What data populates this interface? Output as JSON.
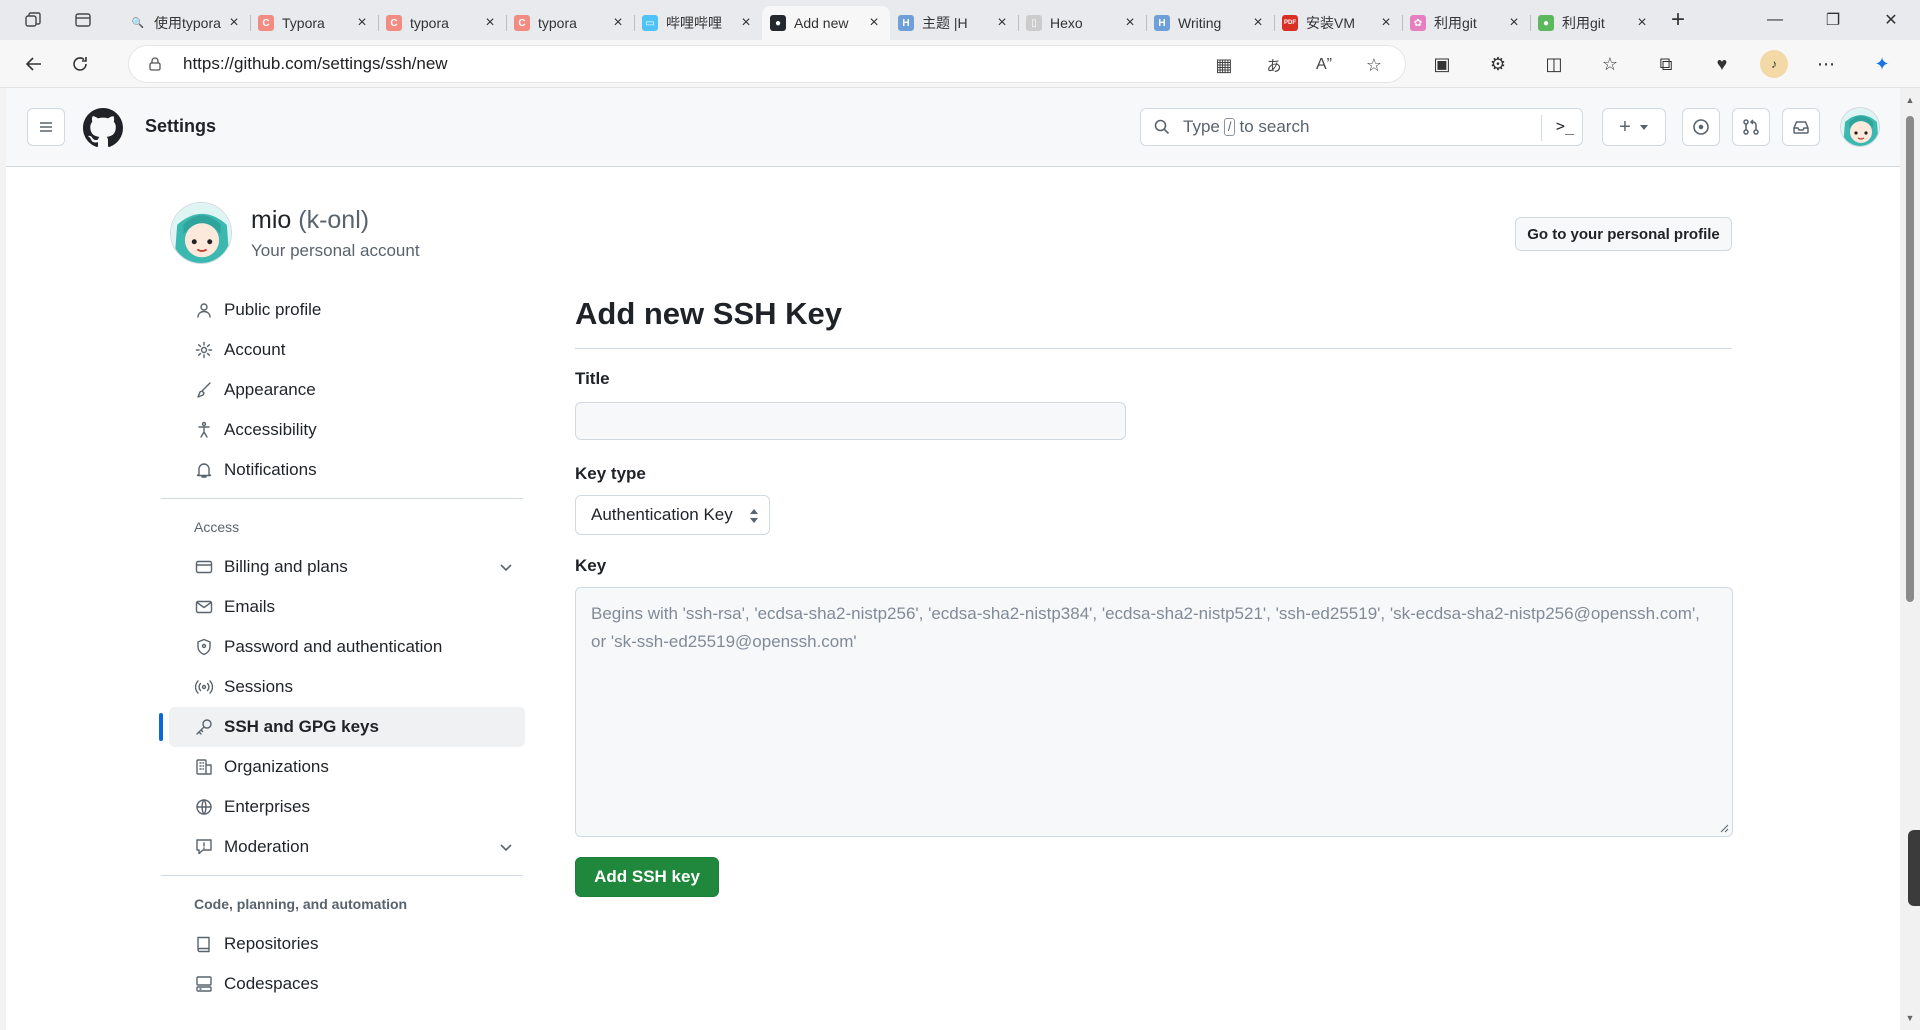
{
  "browser": {
    "tabs": [
      {
        "label": "使用typora",
        "fav_color": "#e8eaed",
        "fav_glyph": "🔍"
      },
      {
        "label": "Typora",
        "fav_color": "#f28b82",
        "fav_glyph": "C"
      },
      {
        "label": "typora",
        "fav_color": "#f28b82",
        "fav_glyph": "C"
      },
      {
        "label": "typora",
        "fav_color": "#f28b82",
        "fav_glyph": "C"
      },
      {
        "label": "哔哩哔哩",
        "fav_color": "#4fc3f7",
        "fav_glyph": "▭"
      },
      {
        "label": "Add new",
        "fav_color": "#24292f",
        "fav_glyph": "●",
        "active": true
      },
      {
        "label": "主题 |H",
        "fav_color": "#6f9fd8",
        "fav_glyph": "H"
      },
      {
        "label": "Hexo",
        "fav_color": "#cccccc",
        "fav_glyph": "▯"
      },
      {
        "label": "Writing",
        "fav_color": "#6f9fd8",
        "fav_glyph": "H"
      },
      {
        "label": "安装VM",
        "fav_color": "#d93025",
        "fav_glyph": "PDF"
      },
      {
        "label": "利用git",
        "fav_color": "#e57fbf",
        "fav_glyph": "✿"
      },
      {
        "label": "利用git",
        "fav_color": "#5cb85c",
        "fav_glyph": "●"
      }
    ],
    "url": "https://github.com/settings/ssh/new"
  },
  "header": {
    "context": "Settings",
    "search_pre": "Type",
    "search_key": "/",
    "search_post": "to search",
    "command_glyph": ">_"
  },
  "profile": {
    "name": "mio",
    "login": "(k-onl)",
    "subtitle": "Your personal account",
    "go_profile": "Go to your personal profile"
  },
  "sidenav": {
    "items_top": [
      {
        "label": "Public profile",
        "icon": "person-icon"
      },
      {
        "label": "Account",
        "icon": "gear-icon"
      },
      {
        "label": "Appearance",
        "icon": "paintbrush-icon"
      },
      {
        "label": "Accessibility",
        "icon": "accessibility-icon"
      },
      {
        "label": "Notifications",
        "icon": "bell-icon"
      }
    ],
    "access_heading": "Access",
    "items_access": [
      {
        "label": "Billing and plans",
        "icon": "credit-card-icon",
        "expandable": true
      },
      {
        "label": "Emails",
        "icon": "mail-icon"
      },
      {
        "label": "Password and authentication",
        "icon": "shield-icon"
      },
      {
        "label": "Sessions",
        "icon": "broadcast-icon"
      },
      {
        "label": "SSH and GPG keys",
        "icon": "key-icon",
        "selected": true
      },
      {
        "label": "Organizations",
        "icon": "organization-icon"
      },
      {
        "label": "Enterprises",
        "icon": "globe-icon"
      },
      {
        "label": "Moderation",
        "icon": "report-icon",
        "expandable": true
      }
    ],
    "code_heading": "Code, planning, and automation",
    "items_code": [
      {
        "label": "Repositories",
        "icon": "repo-icon"
      },
      {
        "label": "Codespaces",
        "icon": "codespaces-icon"
      }
    ]
  },
  "form": {
    "heading": "Add new SSH Key",
    "title_label": "Title",
    "title_value": "",
    "keytype_label": "Key type",
    "keytype_value": "Authentication Key",
    "key_label": "Key",
    "key_placeholder": "Begins with 'ssh-rsa', 'ecdsa-sha2-nistp256', 'ecdsa-sha2-nistp384', 'ecdsa-sha2-nistp521', 'ssh-ed25519', 'sk-ecdsa-sha2-nistp256@openssh.com', or 'sk-ssh-ed25519@openssh.com'",
    "submit": "Add SSH key"
  },
  "colors": {
    "accent_blue": "#0969da",
    "primary_green": "#1f883d",
    "avatar_teal": "#3bb8b0"
  }
}
